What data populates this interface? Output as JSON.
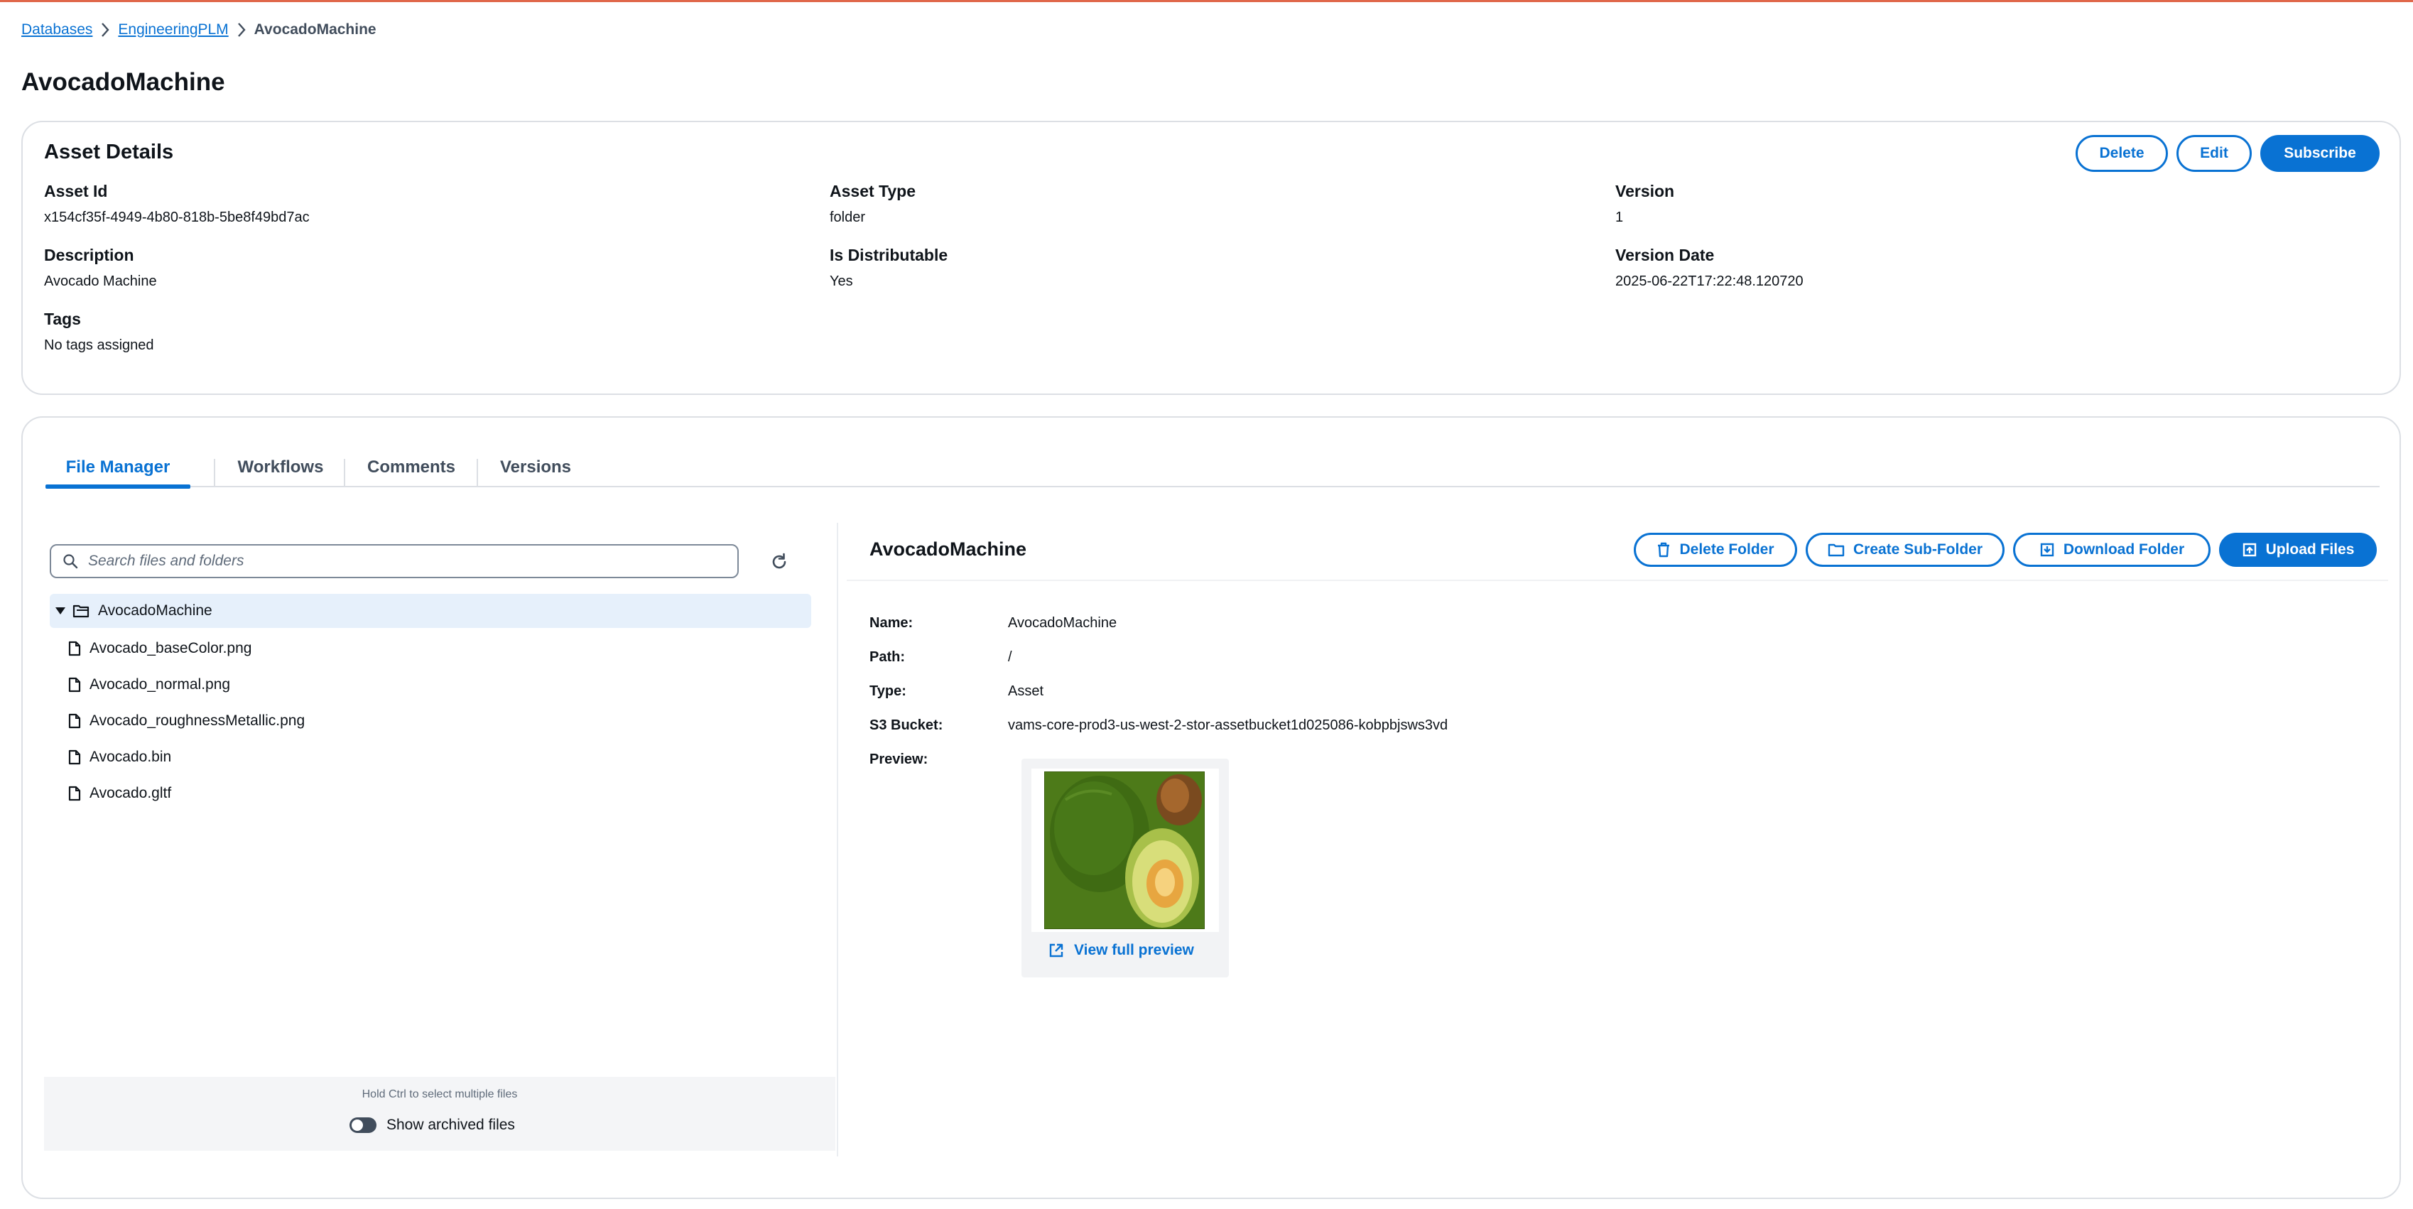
{
  "breadcrumb": {
    "items": [
      "Databases",
      "EngineeringPLM"
    ],
    "current": "AvocadoMachine"
  },
  "page_title": "AvocadoMachine",
  "asset_details": {
    "title": "Asset Details",
    "buttons": {
      "delete": "Delete",
      "edit": "Edit",
      "subscribe": "Subscribe"
    },
    "fields": {
      "asset_id": {
        "label": "Asset Id",
        "value": "x154cf35f-4949-4b80-818b-5be8f49bd7ac"
      },
      "asset_type": {
        "label": "Asset Type",
        "value": "folder"
      },
      "version": {
        "label": "Version",
        "value": "1"
      },
      "description": {
        "label": "Description",
        "value": "Avocado Machine"
      },
      "is_distributable": {
        "label": "Is Distributable",
        "value": "Yes"
      },
      "version_date": {
        "label": "Version Date",
        "value": "2025-06-22T17:22:48.120720"
      },
      "tags": {
        "label": "Tags",
        "value": "No tags assigned"
      }
    }
  },
  "tabs": [
    {
      "label": "File Manager",
      "active": true
    },
    {
      "label": "Workflows",
      "active": false
    },
    {
      "label": "Comments",
      "active": false
    },
    {
      "label": "Versions",
      "active": false
    }
  ],
  "file_manager": {
    "search_placeholder": "Search files and folders",
    "tree": {
      "root": "AvocadoMachine",
      "files": [
        "Avocado_baseColor.png",
        "Avocado_normal.png",
        "Avocado_roughnessMetallic.png",
        "Avocado.bin",
        "Avocado.gltf"
      ]
    },
    "hint": "Hold Ctrl to select multiple files",
    "show_archived_label": "Show archived files",
    "show_archived": false
  },
  "detail": {
    "title": "AvocadoMachine",
    "buttons": {
      "delete_folder": "Delete Folder",
      "create_sub_folder": "Create Sub-Folder",
      "download_folder": "Download Folder",
      "upload_files": "Upload Files"
    },
    "props": {
      "name": {
        "label": "Name:",
        "value": "AvocadoMachine"
      },
      "path": {
        "label": "Path:",
        "value": "/"
      },
      "type": {
        "label": "Type:",
        "value": "Asset"
      },
      "s3_bucket": {
        "label": "S3 Bucket:",
        "value": "vams-core-prod3-us-west-2-stor-assetbucket1d025086-kobpbjsws3vd"
      },
      "preview": {
        "label": "Preview:"
      }
    },
    "view_full_preview": "View full preview"
  },
  "colors": {
    "accent": "#0972d3",
    "top_line": "#e0674a",
    "selected_row": "#e6f0fb"
  }
}
